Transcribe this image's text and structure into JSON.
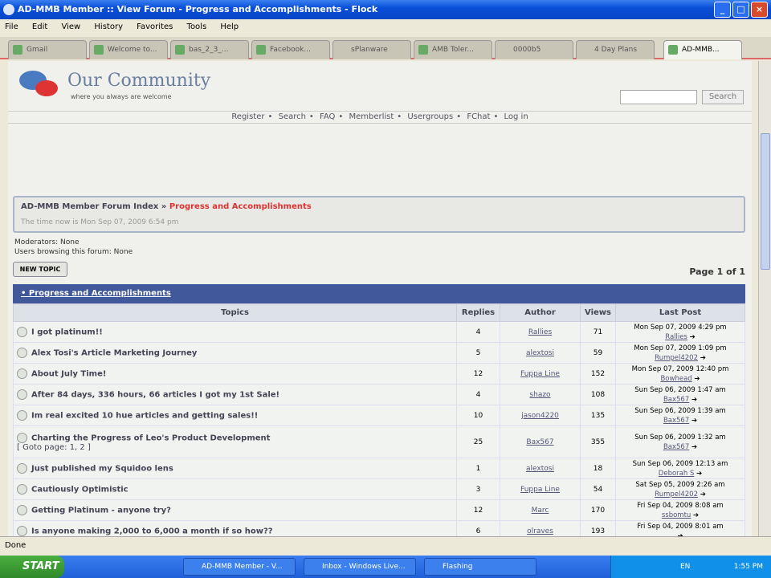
{
  "window": {
    "title": "AD-MMB Member :: View Forum - Progress and Accomplishments - Flock"
  },
  "menu": [
    "File",
    "Edit",
    "View",
    "History",
    "Favorites",
    "Tools",
    "Help"
  ],
  "tabs": [
    "Gmail",
    "Welcome to...",
    "bas_2_3_...",
    "Facebook...",
    "sPlanware",
    "AMB Toler...",
    "0000b5",
    "4 Day Plans",
    "AD-MMB..."
  ],
  "site": {
    "title": "Our Community",
    "tagline": "where you always are welcome",
    "search_button": "Search"
  },
  "nav": [
    "Register",
    "Search",
    "FAQ",
    "Memberlist",
    "Usergroups",
    "FChat",
    "Log in"
  ],
  "breadcrumb": {
    "index": "AD-MMB Member Forum Index",
    "sep": " » ",
    "current": "Progress and Accomplishments",
    "time": "The time now is Mon Sep 07, 2009 6:54 pm"
  },
  "moderators": "Moderators: None",
  "browsing": "Users browsing this forum: None",
  "new_topic": "NEW TOPIC",
  "page_of": "Page 1 of 1",
  "forum_header": "Progress and Accomplishments",
  "columns": [
    "Topics",
    "Replies",
    "Author",
    "Views",
    "Last Post"
  ],
  "topics": [
    {
      "title": "I got platinum!!",
      "replies": "4",
      "author": "Rallies",
      "views": "71",
      "last_date": "Mon Sep 07, 2009 4:29 pm",
      "last_user": "Rallies"
    },
    {
      "title": "Alex Tosi's Article Marketing Journey",
      "replies": "5",
      "author": "alextosi",
      "views": "59",
      "last_date": "Mon Sep 07, 2009 1:09 pm",
      "last_user": "Rumpel4202"
    },
    {
      "title": "About July Time!",
      "replies": "12",
      "author": "Fuppa Line",
      "views": "152",
      "last_date": "Mon Sep 07, 2009 12:40 pm",
      "last_user": "Bowhead"
    },
    {
      "title": "After 84 days, 336 hours, 66 articles I got my 1st Sale!",
      "replies": "4",
      "author": "shazo",
      "views": "108",
      "last_date": "Sun Sep 06, 2009 1:47 am",
      "last_user": "Bax567"
    },
    {
      "title": "Im real excited 10 hue articles and getting sales!!",
      "replies": "10",
      "author": "jason4220",
      "views": "135",
      "last_date": "Sun Sep 06, 2009 1:39 am",
      "last_user": "Bax567"
    },
    {
      "title": "Charting the Progress of Leo's Product Development",
      "pages": "[ Goto page: 1, 2 ]",
      "replies": "25",
      "author": "Bax567",
      "views": "355",
      "last_date": "Sun Sep 06, 2009 1:32 am",
      "last_user": "Bax567"
    },
    {
      "title": "Just published my Squidoo lens",
      "replies": "1",
      "author": "alextosi",
      "views": "18",
      "last_date": "Sun Sep 06, 2009 12:13 am",
      "last_user": "Deborah S"
    },
    {
      "title": "Cautiously Optimistic",
      "replies": "3",
      "author": "Fuppa Line",
      "views": "54",
      "last_date": "Sat Sep 05, 2009 2:26 am",
      "last_user": "Rumpel4202"
    },
    {
      "title": "Getting Platinum - anyone try?",
      "replies": "12",
      "author": "Marc",
      "views": "170",
      "last_date": "Fri Sep 04, 2009 8:08 am",
      "last_user": "ssbomtu"
    },
    {
      "title": "Is anyone making 2,000 to 6,000 a month if so how??",
      "replies": "6",
      "author": "olraves",
      "views": "193",
      "last_date": "Fri Sep 04, 2009 8:01 am",
      "last_user": ""
    }
  ],
  "status": "Done",
  "taskbar": {
    "start": "START",
    "tasks": [
      "AD-MMB Member - V...",
      "Inbox - Windows Live...",
      "Flashing"
    ],
    "clock": "1:55 PM",
    "lang": "EN"
  }
}
